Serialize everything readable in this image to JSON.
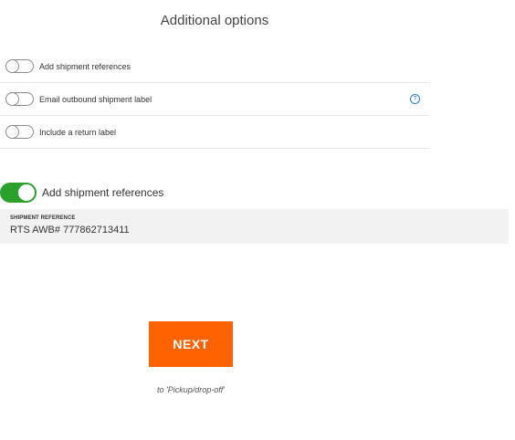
{
  "title": "Additional options",
  "options": [
    {
      "label": "Add shipment references",
      "enabled": false
    },
    {
      "label": "Email outbound shipment label",
      "enabled": false,
      "help_icon": "?"
    },
    {
      "label": "Include a return label",
      "enabled": false
    }
  ],
  "shipment_references": {
    "toggle_label": "Add shipment references",
    "enabled": true,
    "field_label": "SHIPMENT REFERENCE",
    "field_value": "RTS AWB# 777862713411"
  },
  "next_button": {
    "label": "NEXT",
    "subtext": "to 'Pickup/drop-off'"
  },
  "colors": {
    "accent": "#ff6200",
    "toggle_on": "#2ca02c",
    "help_icon": "#2b7ec1",
    "field_bg": "#f2f2f2"
  },
  "icons": [
    "toggle-switch",
    "help-circle-icon"
  ]
}
